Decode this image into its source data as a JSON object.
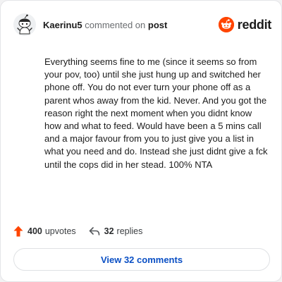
{
  "header": {
    "username": "Kaerinu5",
    "action": "commented on",
    "target": "post",
    "brand": "reddit",
    "avatar_icon": "snoo-avatar-icon",
    "brand_icon": "reddit-logo-icon",
    "brand_color": "#ff4500"
  },
  "comment": {
    "body": "Everything seems fine to me (since it seems so from your pov, too) until she just hung up and switched her phone off. You do not ever turn your phone off as a parent whos away from the kid. Never. And you got the reason right the next moment when you didnt know how and what to feed. Would have been a 5 mins call and a major favour from you to just give you a list in what you need and do. Instead she just didnt give a fck until the cops did in her stead. 100% NTA"
  },
  "stats": {
    "upvotes_count": "400",
    "upvotes_label": "upvotes",
    "replies_count": "32",
    "replies_label": "replies",
    "upvote_icon": "upvote-arrow-icon",
    "reply_icon": "reply-arrow-icon",
    "upvote_color": "#ff4500"
  },
  "footer": {
    "view_comments_label": "View 32 comments",
    "link_color": "#0a4fc4"
  }
}
